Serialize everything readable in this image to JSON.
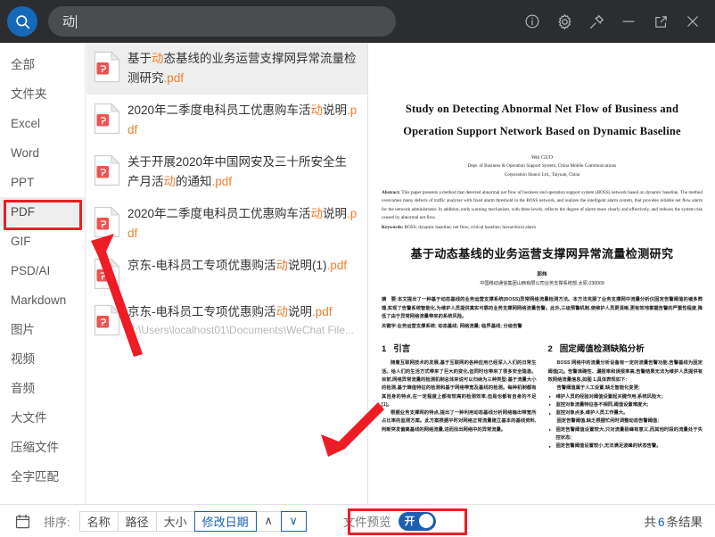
{
  "search": {
    "query": "动",
    "placeholder": "",
    "icon": "search-icon"
  },
  "window_controls": [
    {
      "name": "info-icon",
      "label": "信息"
    },
    {
      "name": "gear-icon",
      "label": "设置"
    },
    {
      "name": "pin-icon",
      "label": "置顶"
    },
    {
      "name": "minimize-icon",
      "label": "最小化"
    },
    {
      "name": "external-link-icon",
      "label": "全屏"
    },
    {
      "name": "close-icon",
      "label": "关闭"
    }
  ],
  "sidebar": {
    "items": [
      {
        "label": "全部",
        "active": false
      },
      {
        "label": "文件夹",
        "active": false
      },
      {
        "label": "Excel",
        "active": false
      },
      {
        "label": "Word",
        "active": false
      },
      {
        "label": "PPT",
        "active": false
      },
      {
        "label": "PDF",
        "active": true
      },
      {
        "label": "GIF",
        "active": false
      },
      {
        "label": "PSD/AI",
        "active": false
      },
      {
        "label": "Markdown",
        "active": false
      },
      {
        "label": "图片",
        "active": false
      },
      {
        "label": "视频",
        "active": false
      },
      {
        "label": "音频",
        "active": false
      },
      {
        "label": "大文件",
        "active": false
      },
      {
        "label": "压缩文件",
        "active": false
      },
      {
        "label": "全字匹配",
        "active": false
      }
    ]
  },
  "results": {
    "rows": [
      {
        "selected": true,
        "icon": "pdf-file-icon",
        "parts": [
          {
            "t": "基于",
            "hl": false
          },
          {
            "t": "动",
            "hl": true
          },
          {
            "t": "态基线的业务运营支撑网异常流量检测研究",
            "hl": false
          },
          {
            "t": ".pdf",
            "ext": true
          }
        ],
        "path": ""
      },
      {
        "selected": false,
        "icon": "pdf-file-icon",
        "parts": [
          {
            "t": "2020年二季度电科员工优惠购车活",
            "hl": false
          },
          {
            "t": "动",
            "hl": true
          },
          {
            "t": "说明",
            "hl": false
          },
          {
            "t": ".pdf",
            "ext": true
          }
        ],
        "path": ""
      },
      {
        "selected": false,
        "icon": "pdf-file-icon",
        "parts": [
          {
            "t": "关于开展2020年中国网安及三十所安全生产月活",
            "hl": false
          },
          {
            "t": "动",
            "hl": true
          },
          {
            "t": "的通知",
            "hl": false
          },
          {
            "t": ".pdf",
            "ext": true
          }
        ],
        "path": ""
      },
      {
        "selected": false,
        "icon": "pdf-file-icon",
        "parts": [
          {
            "t": "2020年二季度电科员工优惠购车活",
            "hl": false
          },
          {
            "t": "动",
            "hl": true
          },
          {
            "t": "说明",
            "hl": false
          },
          {
            "t": ".pdf",
            "ext": true
          }
        ],
        "path": ""
      },
      {
        "selected": false,
        "icon": "pdf-file-icon",
        "parts": [
          {
            "t": "京东-电科员工专项优惠购活",
            "hl": false
          },
          {
            "t": "动",
            "hl": true
          },
          {
            "t": "说明(1)",
            "hl": false
          },
          {
            "t": ".pdf",
            "ext": true
          }
        ],
        "path": ""
      },
      {
        "selected": false,
        "icon": "pdf-file-icon",
        "parts": [
          {
            "t": "京东-电科员工专项优惠购活",
            "hl": false
          },
          {
            "t": "动",
            "hl": true
          },
          {
            "t": "说明",
            "hl": false
          },
          {
            "t": ".pdf",
            "ext": true
          }
        ],
        "path": "C:\\Users\\localhost01\\Documents\\WeChat File..."
      }
    ]
  },
  "preview": {
    "title_en_line1": "Study on Detecting    Abnormal Net Flow of Business and",
    "title_en_line2": "Operation Support Network Based on Dynamic Baseline",
    "author_en": "Wei GUO",
    "affil_en_line1": "Dept. of Business & Operation Support System,  China Mobile Communications",
    "affil_en_line2": "Corporation Shanxi Ltd.,  Taiyuan,  China",
    "abstract_label_en": "Abstract:",
    "abstract_en": " This paper presents a method that detected abnormal net flow of business and operation support system (BOSS) network based on dynamic baseline. The method overcomes many defects of traffic analyzer with fixed alarm threshold in the BOSS network, and realizes the intelligent alarm system, that provides reliable net flow alarm for the network administrator. In addition, early warning mechanism, with three levels, reflects the degree of alarm more clearly and effectively, and reduces the system risk caused by abnormal net flow.",
    "keywords_label_en": "Keywords:",
    "keywords_en": " BOSS;  dynamic baseline;  net flow;  critical baseline;  hierarchical alarm",
    "title_cn": "基于动态基线的业务运营支撑网异常流量检测研究",
    "author_cn": "郭炜",
    "affil_cn": "中国移动通信集团山西有限公司业务支撑系统部,太原,030009",
    "abstract_label_cn": "摘　要:",
    "abstract_cn": "本文提出了一种基于动态基线的业务运营支撑系统(BOSS)异常网络流量检测方法。本方法克服了业务支撑网中流量分析仪固定告警阈值的诸多弊端,实现了告警系统智能化,为维护人员提供真实可靠的业务支撑网网络流量告警。此外,三级预警机制,使维护人员更清晰,更有效地掌握告警的严重性程度,降低了由于异常网络流量带来的系统风险。",
    "keywords_label_cn": "关键字:",
    "keywords_cn": "业务运营支撑系统;  动态基线;  网络流量;  临界基线;  分级告警",
    "sections": [
      {
        "num": "1",
        "title": "引言",
        "paragraphs": [
          "随着互联网技术的发展,基于互联网的各种应用已经深入人们的日常生活。给人们的生活方式带来了巨大的变化,但同时也带来了很多安全隐患。目前,网络异常流量的检测机制总体来说可以归纳为三种类型:基于流量大小的检测,基于熵值特征的检测和基于网络带宽及基线的检测。每种机制都有其自身的特点,在一定程度上都有较高的检测效率,但是也都有自身的不足[1]。",
          "根据业务支撑网的特点,提出了一种利用动态基线分析网络输出带宽所占比率的监测方案。此方案根据平时对网络正常流量建立基本的基线资料,判断突发偏离基线的网络流量,进而找出网络中的异常流量。"
        ],
        "bullets": []
      },
      {
        "num": "2",
        "title": "固定阈值检测缺陷分析",
        "paragraphs": [
          "BOSS 网络中的流量分析设备有一定的流量告警功能,告警基线为固定阈值[2]。告警准确性、漏报率和误报率高,告警结果无法为维护人员提供有效网络流量信息,如图 1,具体表现如下:",
          "告警阈值属于人工设置,缺乏智能化变更;",
          "固定告警阈值,缺乏根据忙闲时调整动态告警阈值;"
        ],
        "bullets": [
          "维护人员的经验对阈值设置起关键作用,系统风险大;",
          "监控对象流量特征各不相同,阈值设置难度大;",
          "监控对象点多,维护人员工作量大。",
          "固定告警阈值设置较大,只对流量极峰有意义,而其他时段的流量处于失控状态;",
          "固定告警阈值设置较小,无法满足波峰的状态告警。"
        ]
      }
    ]
  },
  "bottombar": {
    "calendar_icon": "calendar-icon",
    "sort_label": "排序:",
    "sort_options": [
      {
        "label": "名称",
        "active": false
      },
      {
        "label": "路径",
        "active": false
      },
      {
        "label": "大小",
        "active": false
      },
      {
        "label": "修改日期",
        "active": true
      }
    ],
    "asc_label": "∧",
    "desc_label": "∨",
    "asc_active": false,
    "desc_active": true,
    "preview_toggle_label": "文件预览",
    "preview_toggle_state": "开",
    "result_prefix": "共",
    "result_count": "6",
    "result_suffix": "条结果"
  },
  "colors": {
    "accent_blue": "#1a5fb4",
    "topbar_bg": "#2b2d30",
    "highlight_orange": "#f08030",
    "annotation_red": "#ee1c25",
    "pdf_icon_red": "#ef5350"
  }
}
